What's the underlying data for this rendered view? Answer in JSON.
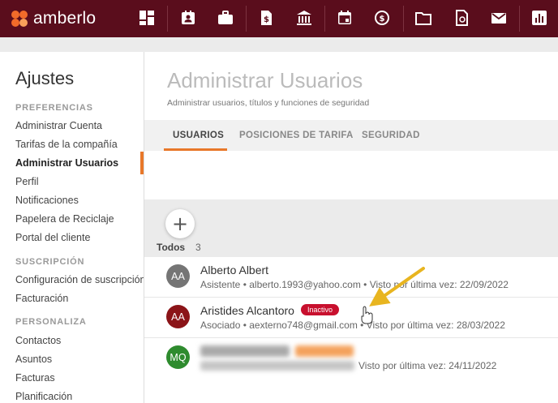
{
  "app": {
    "brand": "amberlo"
  },
  "nav": {
    "icons": [
      "dashboard-icon",
      "contacts-icon",
      "briefcase-icon",
      "billing-icon",
      "bank-icon",
      "calendar-icon",
      "time-icon",
      "folder-icon",
      "document-icon",
      "mail-icon",
      "reports-icon"
    ]
  },
  "sidebar": {
    "title": "Ajustes",
    "sections": [
      {
        "heading": "PREFERENCIAS",
        "items": [
          "Administrar Cuenta",
          "Tarifas de la compañía",
          "Administrar Usuarios",
          "Perfil",
          "Notificaciones",
          "Papelera de Reciclaje",
          "Portal del cliente"
        ]
      },
      {
        "heading": "SUSCRIPCIÓN",
        "items": [
          "Configuración de suscripción",
          "Facturación"
        ]
      },
      {
        "heading": "PERSONALIZA",
        "items": [
          "Contactos",
          "Asuntos",
          "Facturas",
          "Planificación"
        ]
      }
    ],
    "active_item": "Administrar Usuarios"
  },
  "main": {
    "title": "Administrar Usuarios",
    "subtitle": "Administrar usuarios, títulos y funciones de seguridad",
    "tabs": [
      "USUARIOS",
      "POSICIONES DE TARIFA",
      "SEGURIDAD"
    ],
    "active_tab": "USUARIOS",
    "add_symbol": "+",
    "filter_label": "Todos",
    "count": "3"
  },
  "users": [
    {
      "initials": "AA",
      "color": "#757575",
      "name": "Alberto Albert",
      "meta": "Asistente  •  alberto.1993@yahoo.com  •  Visto por última vez: 22/09/2022"
    },
    {
      "initials": "AA",
      "color": "#8b1418",
      "name": "Aristides Alcantoro",
      "badge": "Inactivo",
      "meta": "Asociado  •  aexterno748@gmail.com  •  Visto por última vez: 28/03/2022"
    },
    {
      "initials": "MQ",
      "color": "#2e8b2e",
      "meta": "Visto por última vez: 24/11/2022"
    }
  ],
  "colors": {
    "topbar": "#5a0d1c",
    "accent": "#e8782a",
    "badge": "#c8102e"
  }
}
